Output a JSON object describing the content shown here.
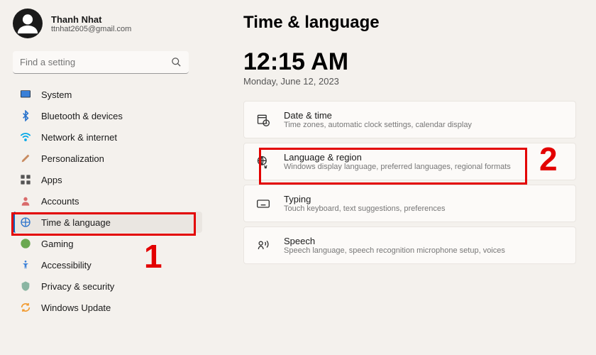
{
  "user": {
    "name": "Thanh Nhat",
    "email": "ttnhat2605@gmail.com"
  },
  "search": {
    "placeholder": "Find a setting"
  },
  "sidebar": {
    "items": [
      {
        "label": "System"
      },
      {
        "label": "Bluetooth & devices"
      },
      {
        "label": "Network & internet"
      },
      {
        "label": "Personalization"
      },
      {
        "label": "Apps"
      },
      {
        "label": "Accounts"
      },
      {
        "label": "Time & language"
      },
      {
        "label": "Gaming"
      },
      {
        "label": "Accessibility"
      },
      {
        "label": "Privacy & security"
      },
      {
        "label": "Windows Update"
      }
    ]
  },
  "page": {
    "title": "Time & language",
    "clock": "12:15 AM",
    "date": "Monday, June 12, 2023"
  },
  "cards": [
    {
      "title": "Date & time",
      "sub": "Time zones, automatic clock settings, calendar display"
    },
    {
      "title": "Language & region",
      "sub": "Windows display language, preferred languages, regional formats"
    },
    {
      "title": "Typing",
      "sub": "Touch keyboard, text suggestions, preferences"
    },
    {
      "title": "Speech",
      "sub": "Speech language, speech recognition microphone setup, voices"
    }
  ],
  "annotations": {
    "n1": "1",
    "n2": "2"
  }
}
